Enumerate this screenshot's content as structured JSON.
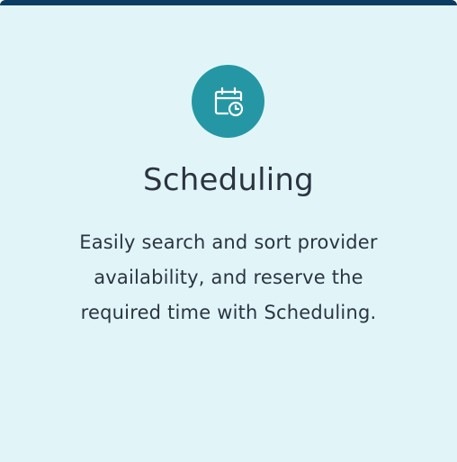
{
  "card": {
    "icon": "calendar-clock-icon",
    "title": "Scheduling",
    "description": "Easily search and sort provider availability, and reserve the required time with Scheduling."
  },
  "colors": {
    "background": "#e1f5f9",
    "top_border": "#0b3c61",
    "icon_badge": "#2597a4",
    "text": "#2b3440"
  }
}
